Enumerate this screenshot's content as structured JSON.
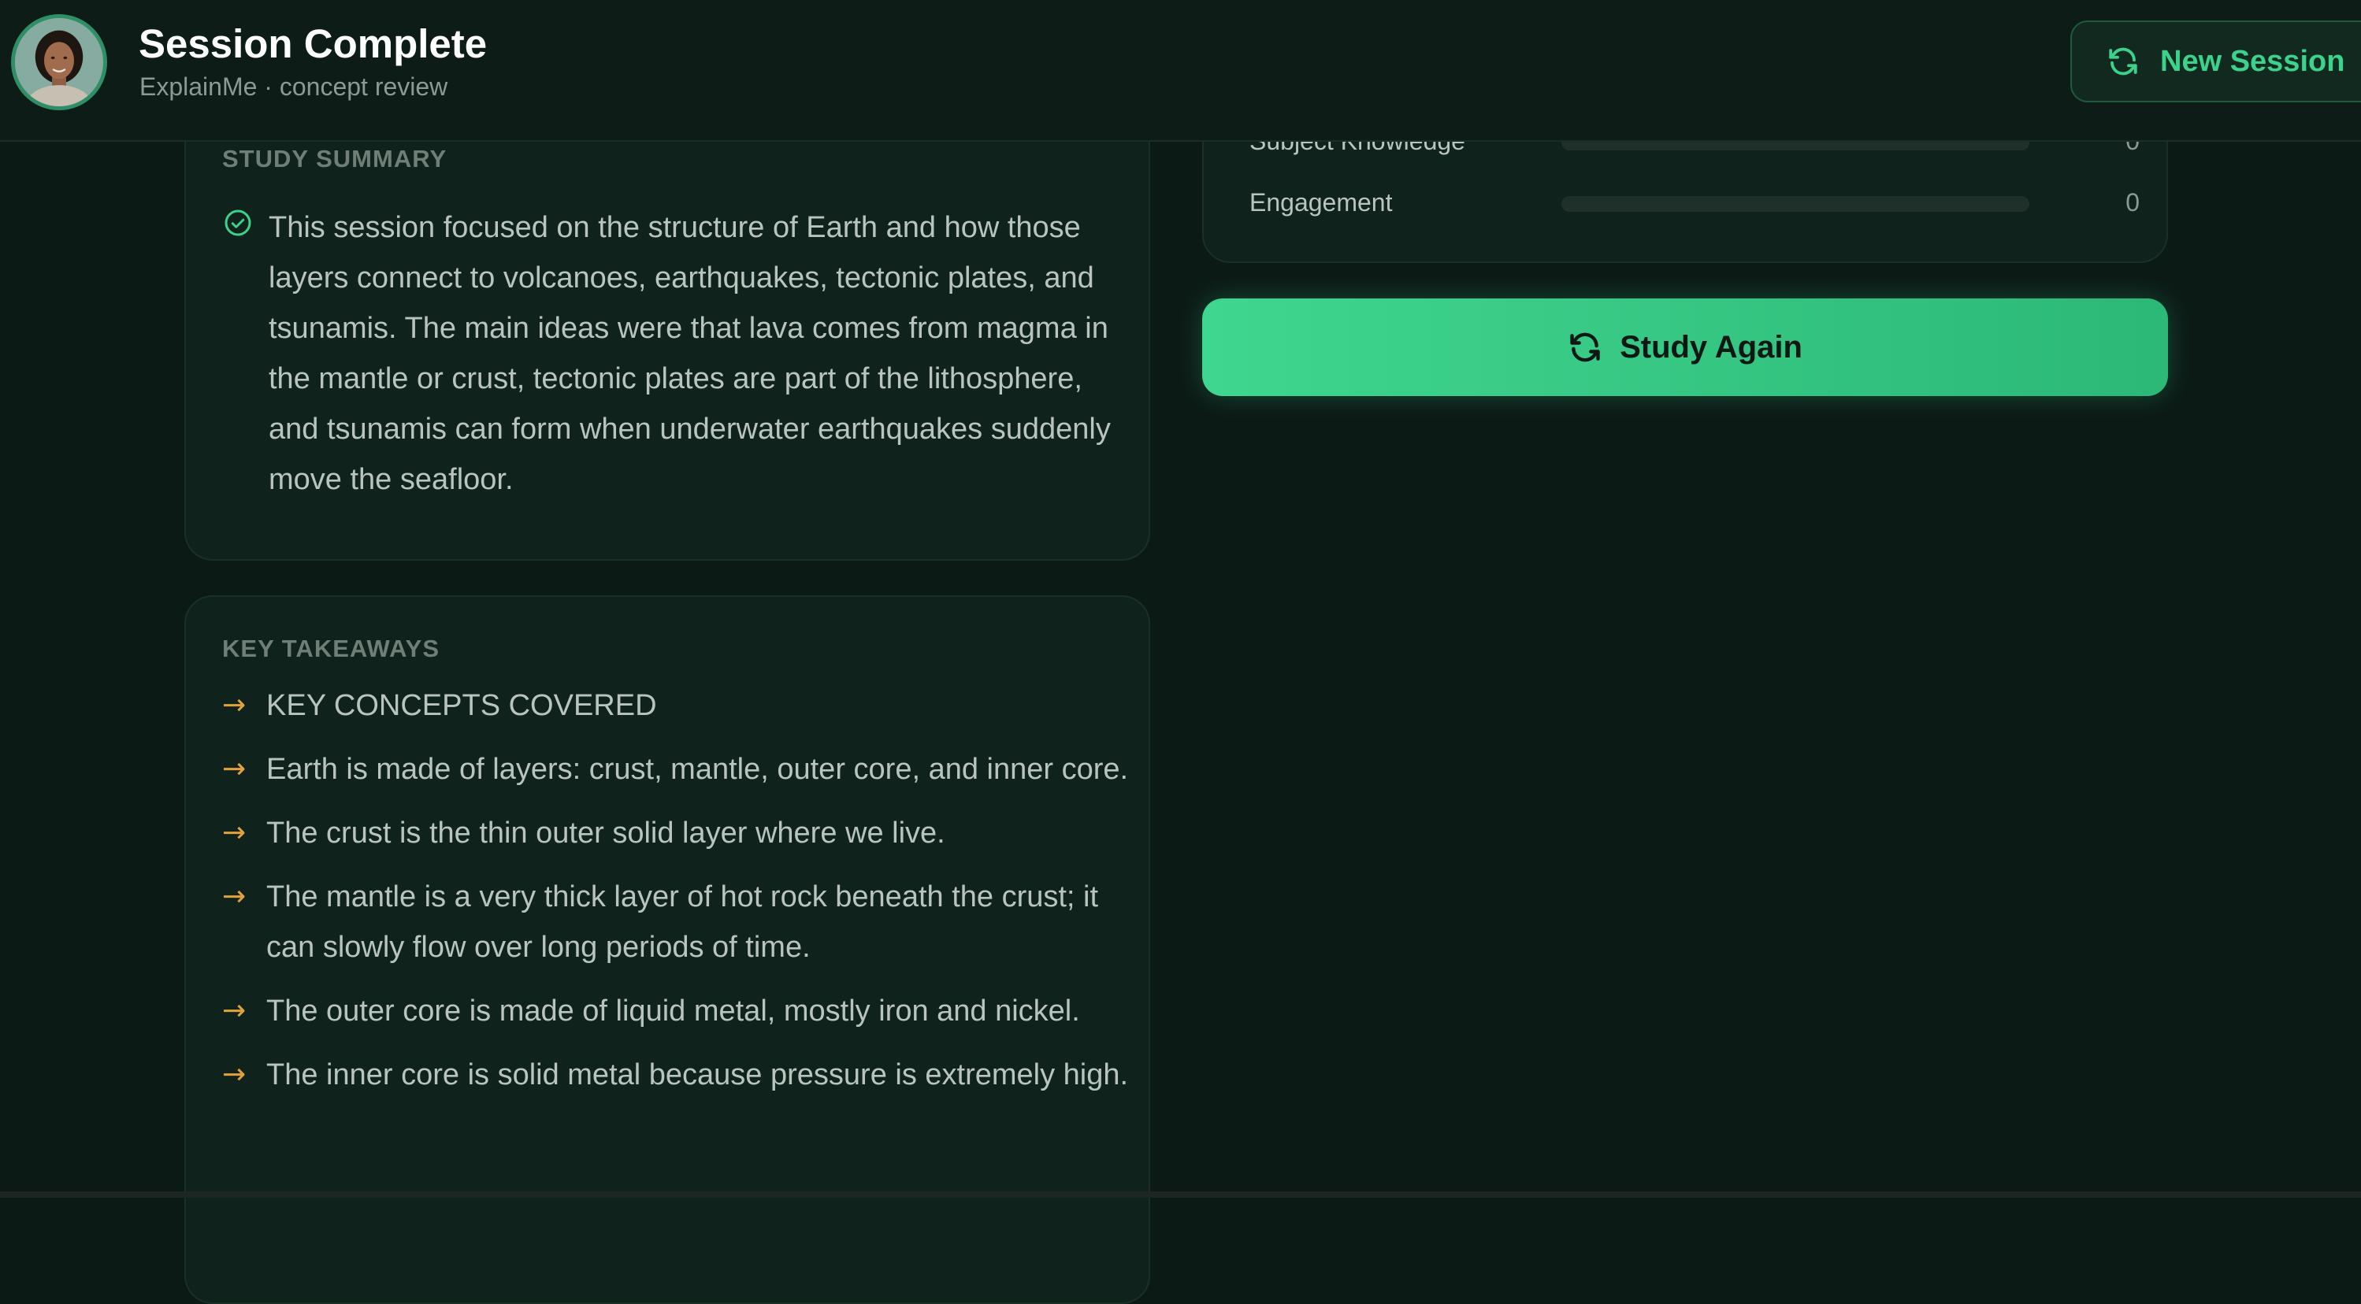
{
  "header": {
    "title": "Session Complete",
    "subtitle": "ExplainMe · concept review",
    "new_session_label": "New Session"
  },
  "summary": {
    "label": "STUDY SUMMARY",
    "text": "This session focused on the structure of Earth and how those layers connect to volcanoes, earthquakes, tectonic plates, and tsunamis. The main ideas were that lava comes from magma in the mantle or crust, tectonic plates are part of the lithosphere, and tsunamis can form when underwater earthquakes suddenly move the seafloor."
  },
  "takeaways": {
    "label": "KEY TAKEAWAYS",
    "items": [
      "KEY CONCEPTS COVERED",
      "Earth is made of layers: crust, mantle, outer core, and inner core.",
      "The crust is the thin outer solid layer where we live.",
      "The mantle is a very thick layer of hot rock beneath the crust; it can slowly flow over long periods of time.",
      "The outer core is made of liquid metal, mostly iron and nickel.",
      "The inner core is solid metal because pressure is extremely high."
    ]
  },
  "metrics": [
    {
      "label": "Subject Knowledge",
      "value": "0",
      "progress": 0
    },
    {
      "label": "Engagement",
      "value": "0",
      "progress": 0
    }
  ],
  "study_again_label": "Study Again",
  "colors": {
    "background": "#0c1a16",
    "card": "#0f221b",
    "accent": "#3bd28b",
    "arrow": "#e2a23a"
  },
  "icons": {
    "new_session": "refresh-icon",
    "study_again": "refresh-icon",
    "summary": "check-circle-icon",
    "takeaway_bullet": "arrow-right-icon"
  }
}
